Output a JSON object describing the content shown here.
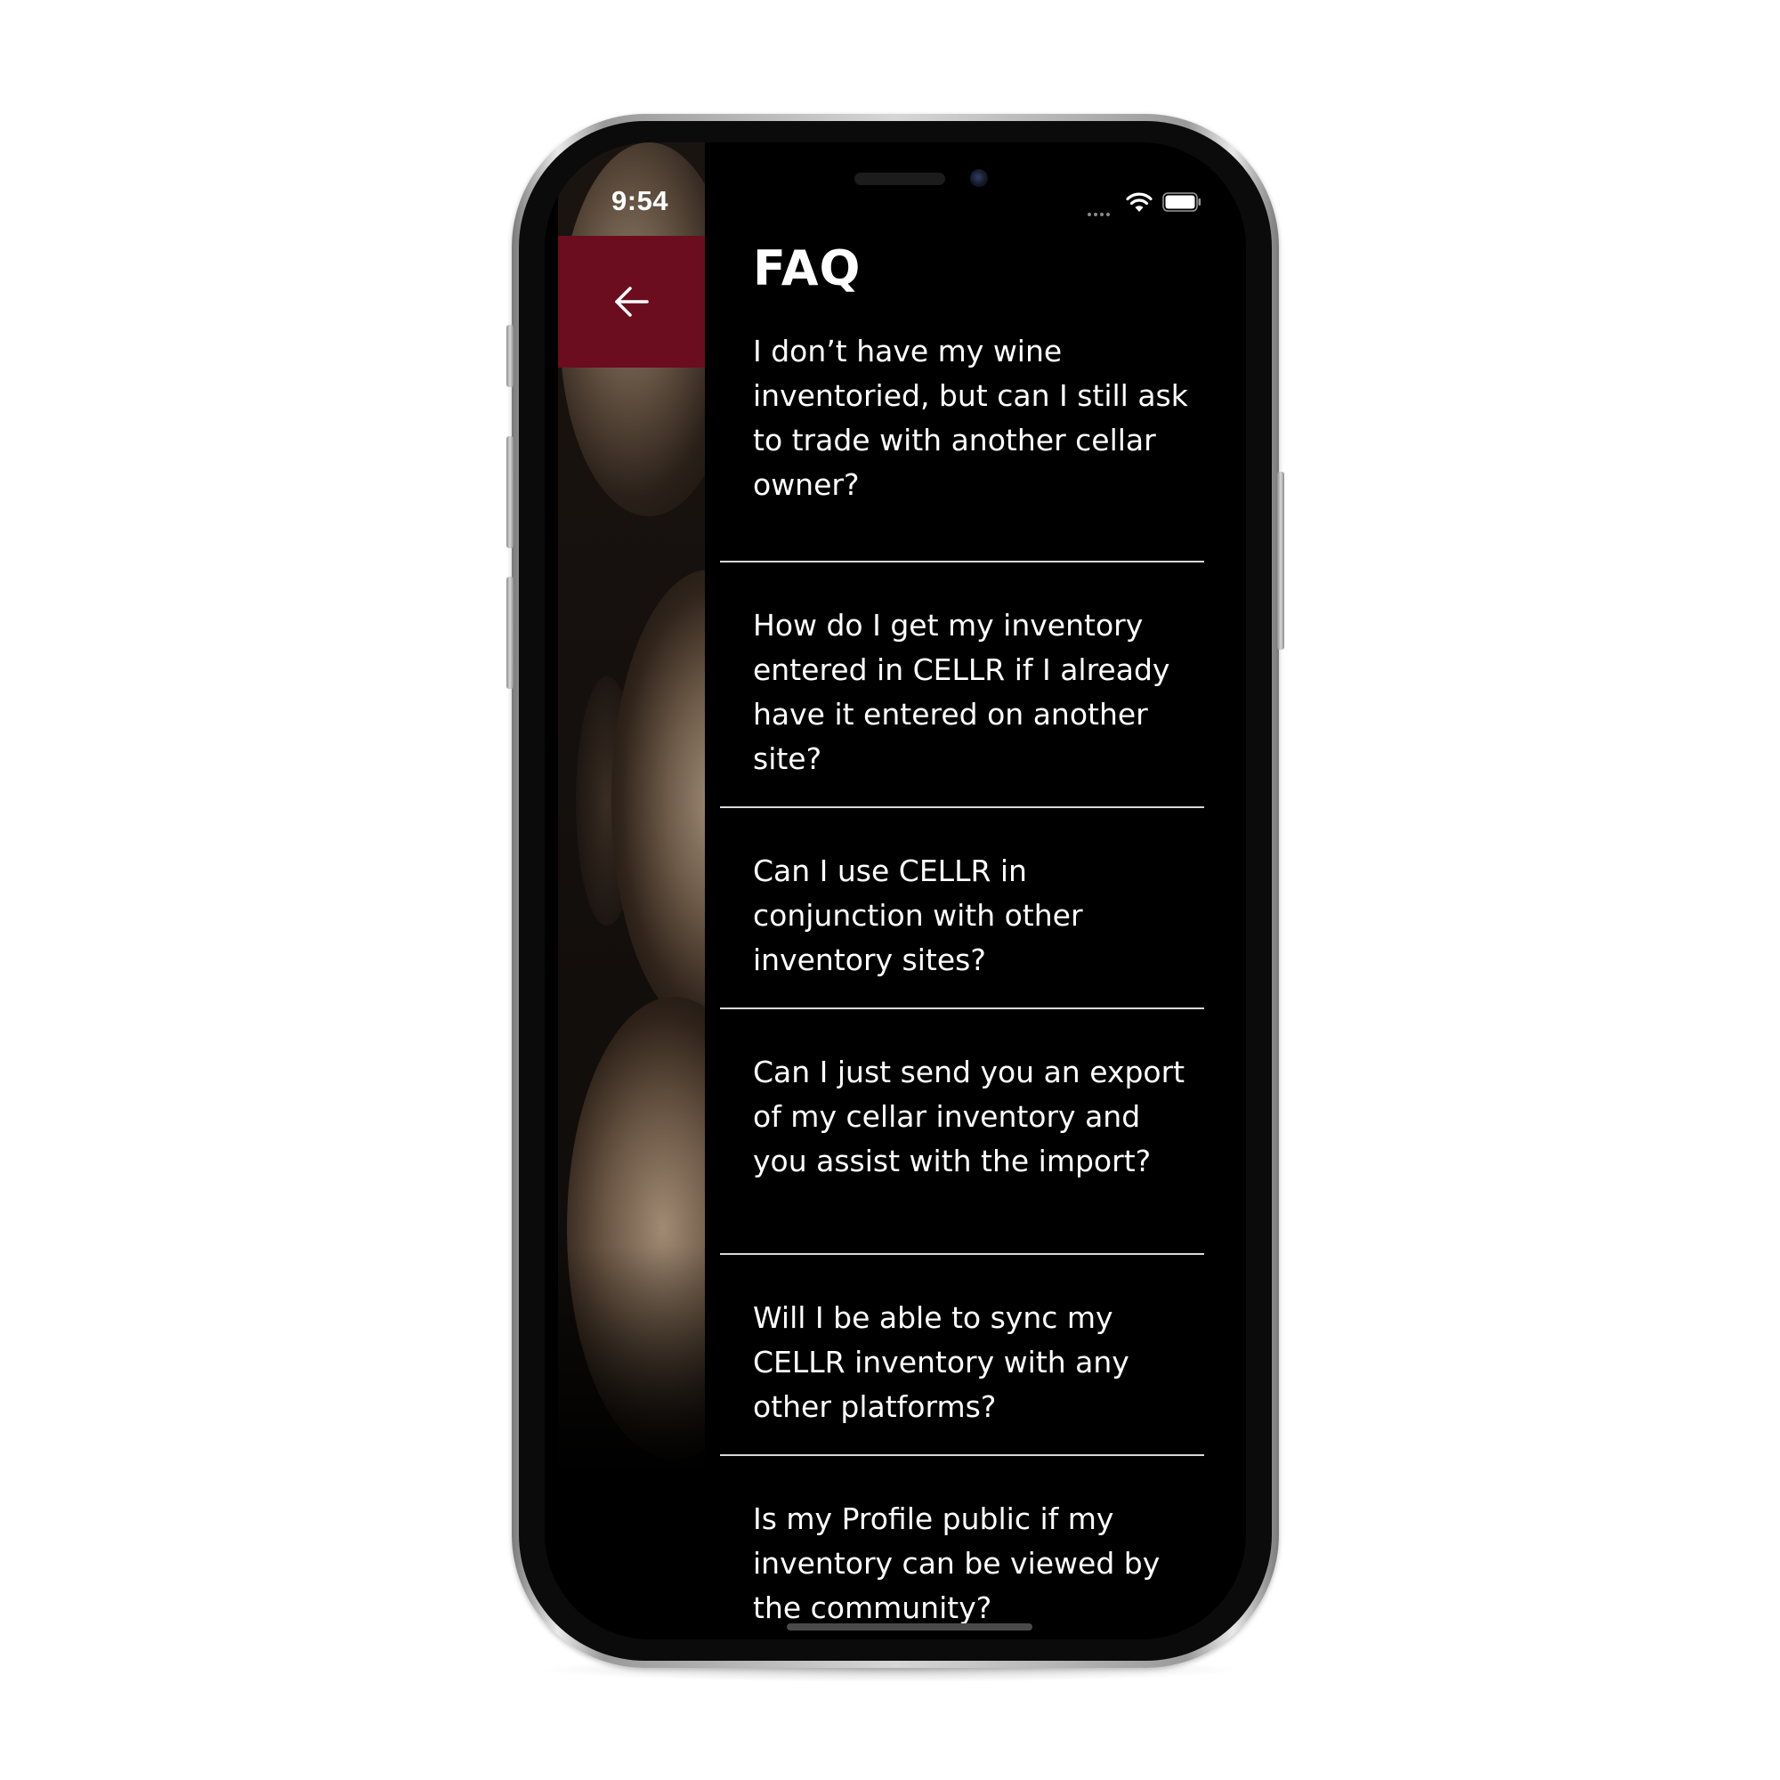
{
  "status_bar": {
    "time": "9:54",
    "icons": [
      "signal-dots-icon",
      "wifi-icon",
      "battery-icon"
    ]
  },
  "header": {
    "back_icon": "arrow-left-icon",
    "title": "FAQ"
  },
  "faq": {
    "items": [
      {
        "question": "I don’t have my wine inventoried, but can I still ask to trade with another cellar owner?"
      },
      {
        "question": "How do I get my inventory entered in CELLR if I already have it entered on another site?"
      },
      {
        "question": "Can I use CELLR in conjunction with other inventory sites?"
      },
      {
        "question": "Can I just send you an export of my cellar inventory and you assist with the import?"
      },
      {
        "question": "Will I be able to sync my CELLR inventory with any other platforms?"
      },
      {
        "question": "Is my Profile public if my inventory can be viewed by the community?"
      }
    ]
  },
  "colors": {
    "accent": "#6b0d1e",
    "background": "#000000",
    "text": "#ffffff",
    "divider": "#d9d9d9"
  }
}
